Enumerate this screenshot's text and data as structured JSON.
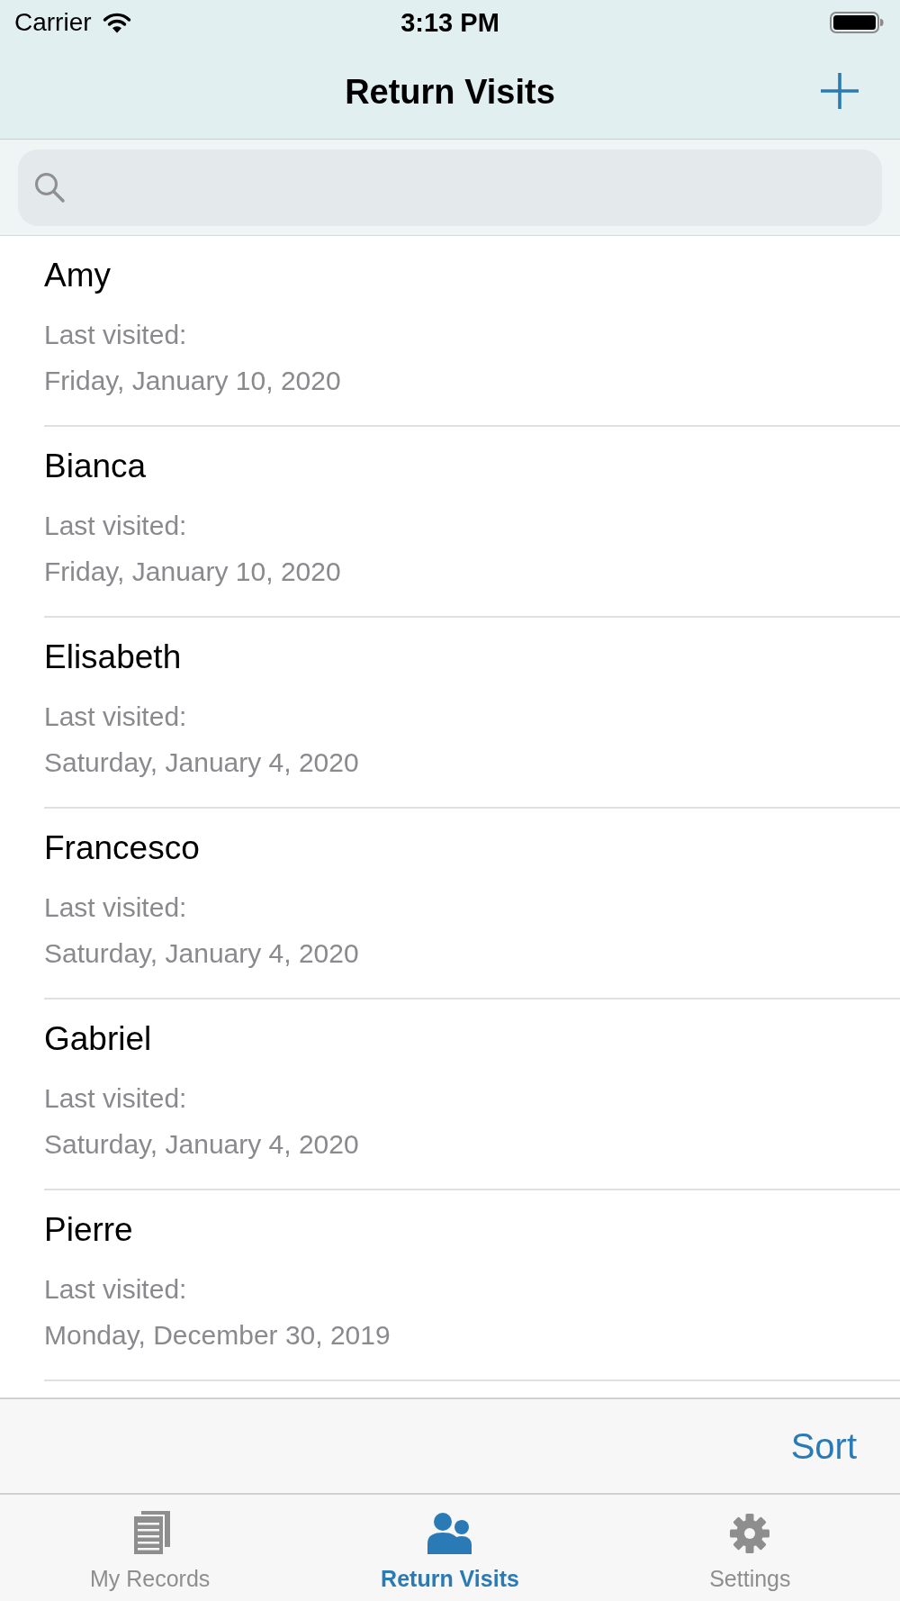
{
  "status_bar": {
    "carrier": "Carrier",
    "time": "3:13 PM"
  },
  "nav_bar": {
    "title": "Return Visits"
  },
  "visits": [
    {
      "name": "Amy",
      "label": "Last visited:",
      "date": "Friday, January 10, 2020"
    },
    {
      "name": "Bianca",
      "label": "Last visited:",
      "date": "Friday, January 10, 2020"
    },
    {
      "name": "Elisabeth",
      "label": "Last visited:",
      "date": "Saturday, January 4, 2020"
    },
    {
      "name": "Francesco",
      "label": "Last visited:",
      "date": "Saturday, January 4, 2020"
    },
    {
      "name": "Gabriel",
      "label": "Last visited:",
      "date": "Saturday, January 4, 2020"
    },
    {
      "name": "Pierre",
      "label": "Last visited:",
      "date": "Monday, December 30, 2019"
    }
  ],
  "toolbar": {
    "sort_button": "Sort"
  },
  "tab_bar": {
    "tabs": [
      {
        "label": "My Records",
        "selected": false
      },
      {
        "label": "Return Visits",
        "selected": true
      },
      {
        "label": "Settings",
        "selected": false
      }
    ]
  }
}
